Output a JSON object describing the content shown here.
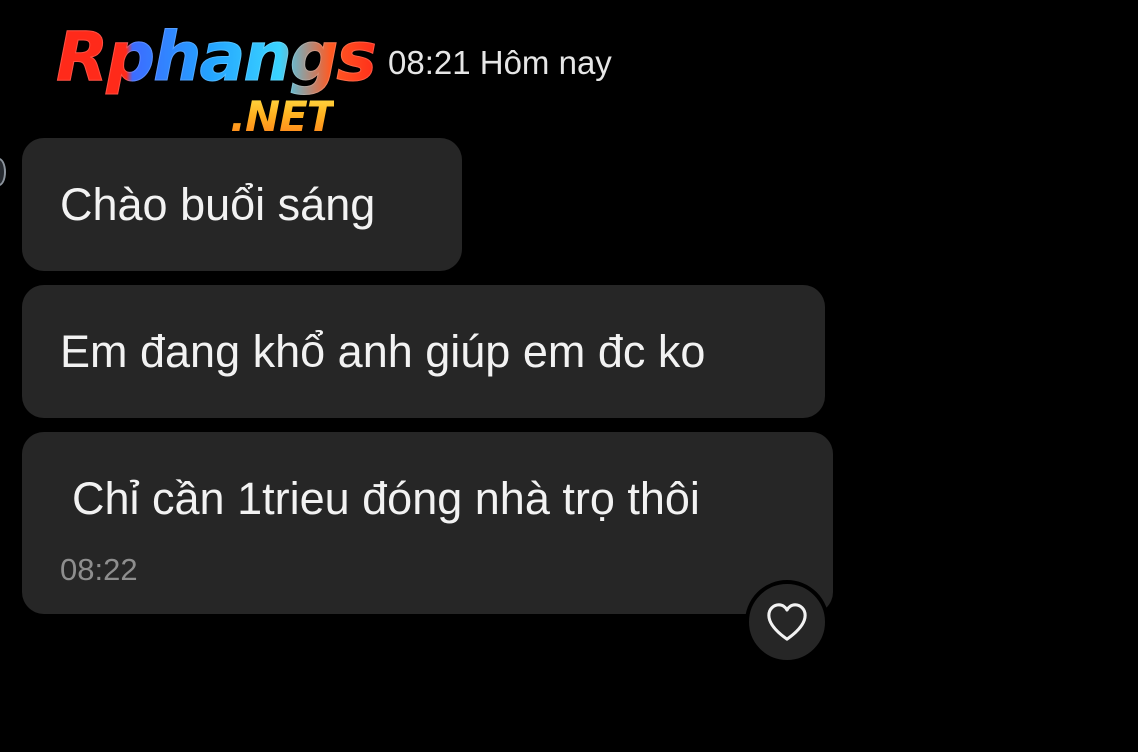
{
  "watermark": {
    "logo_text": "Rphangs",
    "logo_suffix": ".NET"
  },
  "header": {
    "timestamp": "08:21 Hôm nay"
  },
  "messages": [
    {
      "text": "Chào buổi sáng"
    },
    {
      "text": "Em đang khổ anh giúp em đc ko"
    },
    {
      "text": "Chỉ cần 1trieu đóng nhà trọ thôi",
      "time": "08:22"
    }
  ],
  "reaction": {
    "icon": "heart-outline-icon"
  },
  "colors": {
    "background": "#000000",
    "bubble": "#262626",
    "text": "#f2f2f2",
    "time_text": "#8e8e8e"
  }
}
